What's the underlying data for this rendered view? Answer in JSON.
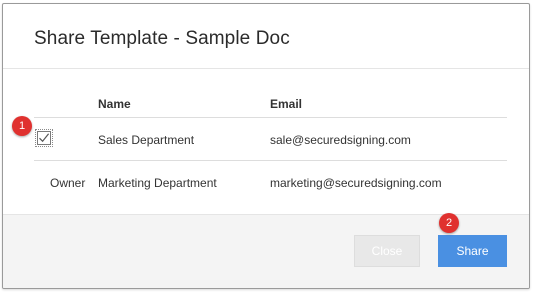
{
  "dialog": {
    "title": "Share Template - Sample Doc"
  },
  "table": {
    "columns": {
      "name": "Name",
      "email": "Email"
    },
    "rows": [
      {
        "role": "",
        "selected": true,
        "name": "Sales Department",
        "email": "sale@securedsigning.com"
      },
      {
        "role": "Owner",
        "selected": false,
        "name": "Marketing Department",
        "email": "marketing@securedsigning.com"
      }
    ]
  },
  "callouts": {
    "one": "1",
    "two": "2"
  },
  "footer": {
    "close_label": "Close",
    "share_label": "Share"
  },
  "colors": {
    "share_button": "#4a90e2",
    "callout": "#e0312f",
    "close_button_disabled": "#e8e8e8"
  },
  "icons": {
    "checkbox": "checkmark-icon"
  }
}
